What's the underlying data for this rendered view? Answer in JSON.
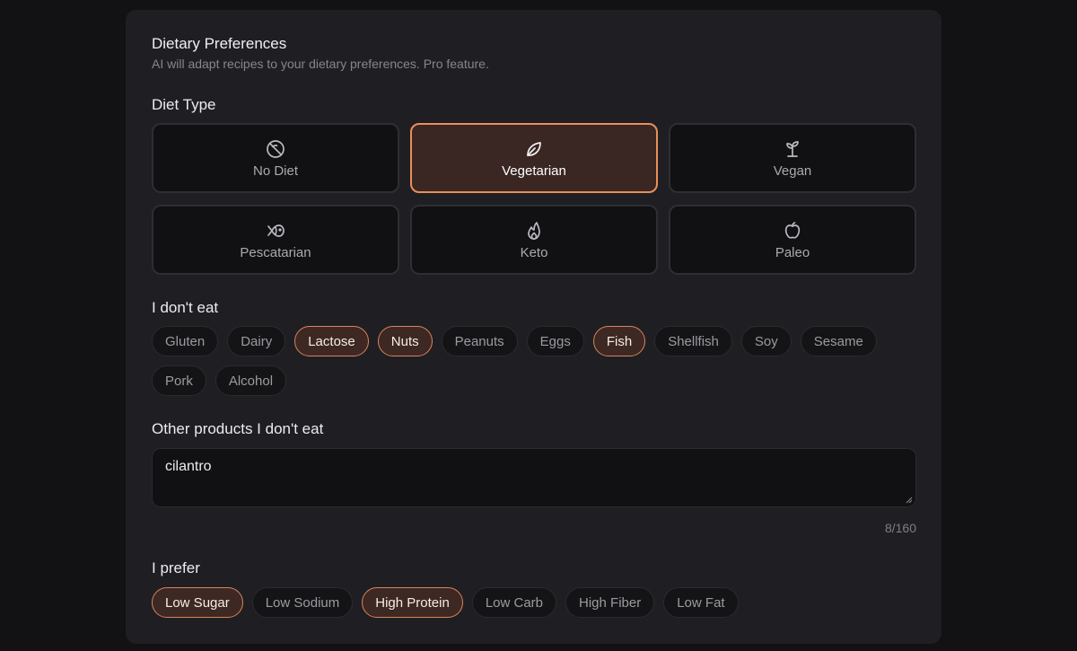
{
  "header": {
    "title": "Dietary Preferences",
    "subtitle": "AI will adapt recipes to your dietary preferences. Pro feature."
  },
  "diet_type": {
    "label": "Diet Type",
    "options": [
      {
        "label": "No Diet",
        "icon": "no-diet-icon",
        "selected": false
      },
      {
        "label": "Vegetarian",
        "icon": "leaf-icon",
        "selected": true
      },
      {
        "label": "Vegan",
        "icon": "sprout-icon",
        "selected": false
      },
      {
        "label": "Pescatarian",
        "icon": "fish-icon",
        "selected": false
      },
      {
        "label": "Keto",
        "icon": "flame-icon",
        "selected": false
      },
      {
        "label": "Paleo",
        "icon": "apple-icon",
        "selected": false
      }
    ]
  },
  "exclusions": {
    "label": "I don't eat",
    "items": [
      {
        "label": "Gluten",
        "selected": false
      },
      {
        "label": "Dairy",
        "selected": false
      },
      {
        "label": "Lactose",
        "selected": true
      },
      {
        "label": "Nuts",
        "selected": true
      },
      {
        "label": "Peanuts",
        "selected": false
      },
      {
        "label": "Eggs",
        "selected": false
      },
      {
        "label": "Fish",
        "selected": true
      },
      {
        "label": "Shellfish",
        "selected": false
      },
      {
        "label": "Soy",
        "selected": false
      },
      {
        "label": "Sesame",
        "selected": false
      },
      {
        "label": "Pork",
        "selected": false
      },
      {
        "label": "Alcohol",
        "selected": false
      }
    ]
  },
  "other_products": {
    "label": "Other products I don't eat",
    "value": "cilantro",
    "counter": "8/160"
  },
  "preferences": {
    "label": "I prefer",
    "items": [
      {
        "label": "Low Sugar",
        "selected": true
      },
      {
        "label": "Low Sodium",
        "selected": false
      },
      {
        "label": "High Protein",
        "selected": true
      },
      {
        "label": "Low Carb",
        "selected": false
      },
      {
        "label": "High Fiber",
        "selected": false
      },
      {
        "label": "Low Fat",
        "selected": false
      }
    ]
  },
  "colors": {
    "accent": "#e98f5b",
    "selected_bg": "#3a2623",
    "panel_bg": "#1f1f23",
    "page_bg": "#121215"
  }
}
